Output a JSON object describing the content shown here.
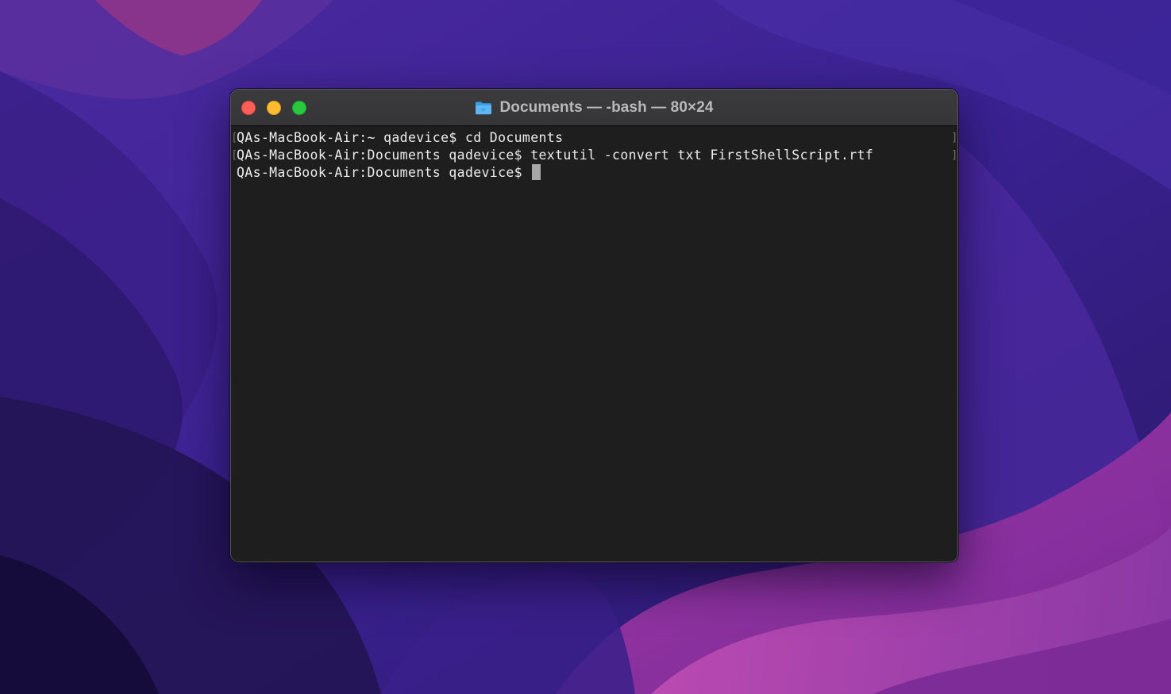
{
  "window": {
    "title": "Documents — -bash — 80×24",
    "icon": "folder-icon"
  },
  "terminal": {
    "lines": [
      "QAs-MacBook-Air:~ qadevice$ cd Documents",
      "QAs-MacBook-Air:Documents qadevice$ textutil -convert txt FirstShellScript.rtf",
      "QAs-MacBook-Air:Documents qadevice$ "
    ],
    "mark_open": "[",
    "mark_close": "]"
  },
  "colors": {
    "close": "#ff5f57",
    "minimize": "#febc2e",
    "zoom": "#28c840",
    "terminal_bg": "#1e1e1e",
    "terminal_text": "#ececec"
  }
}
